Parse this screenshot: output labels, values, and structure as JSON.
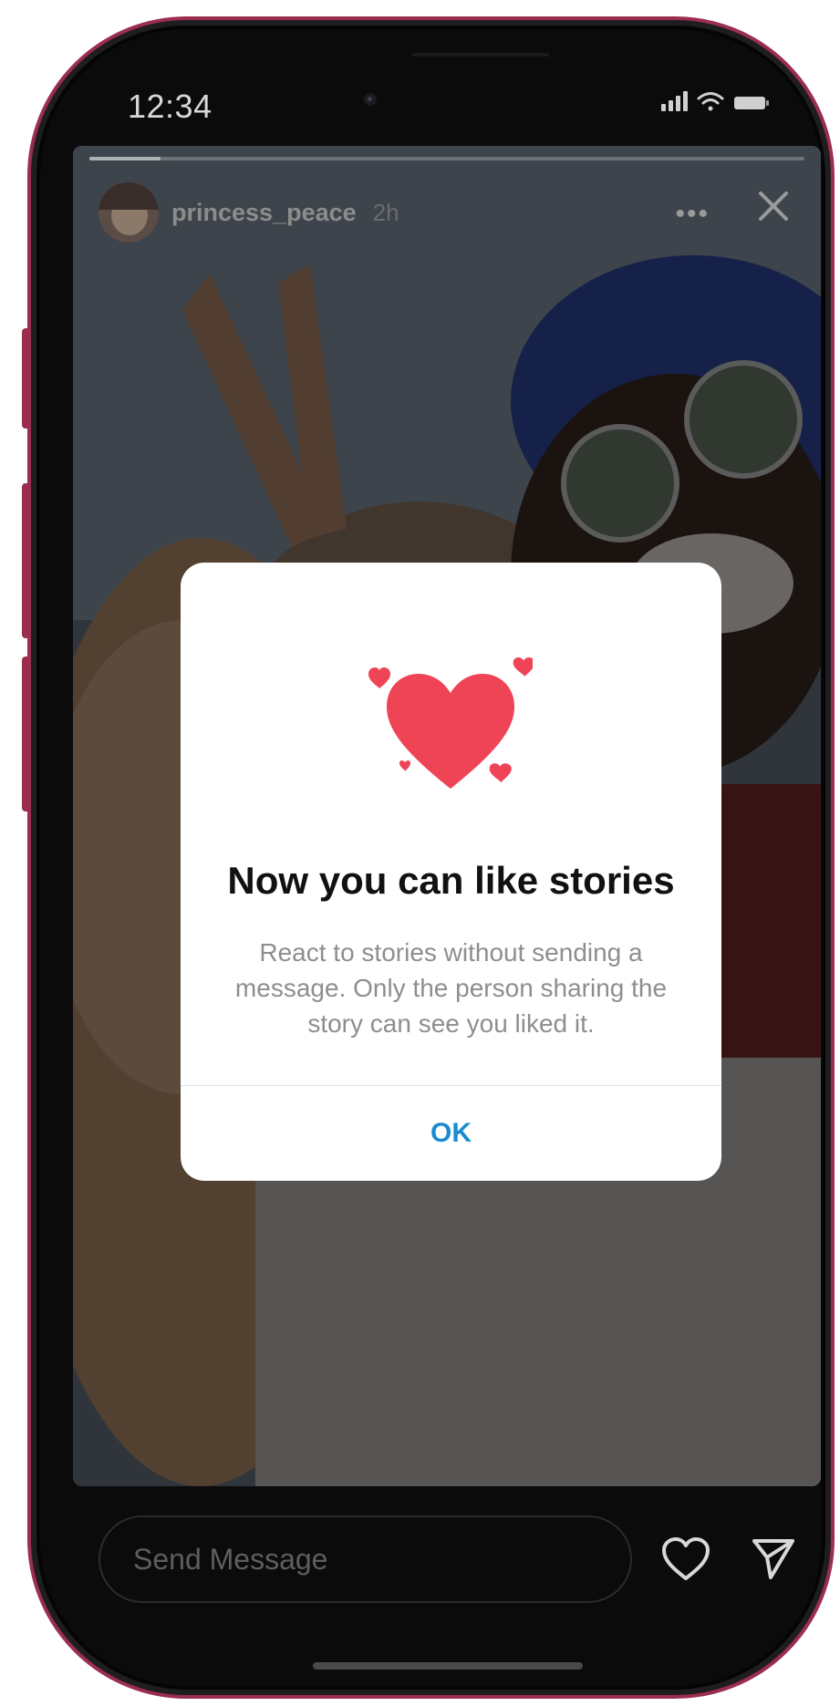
{
  "status_bar": {
    "time": "12:34"
  },
  "story": {
    "username": "princess_peace",
    "time_ago": "2h",
    "more_icon": "more-horizontal-icon",
    "close_icon": "close-icon",
    "progress": 0.1
  },
  "dialog": {
    "icon": "hearts-icon",
    "title": "Now you can like stories",
    "body": "React to stories without sending a message. Only the person sharing the story can see you liked it.",
    "ok_label": "OK"
  },
  "footer": {
    "message_placeholder": "Send Message",
    "like_icon": "heart-outline-icon",
    "send_icon": "send-icon"
  },
  "colors": {
    "accent": "#1a8ccf",
    "heart": "#ef4456",
    "frame": "#9b2e4e"
  }
}
